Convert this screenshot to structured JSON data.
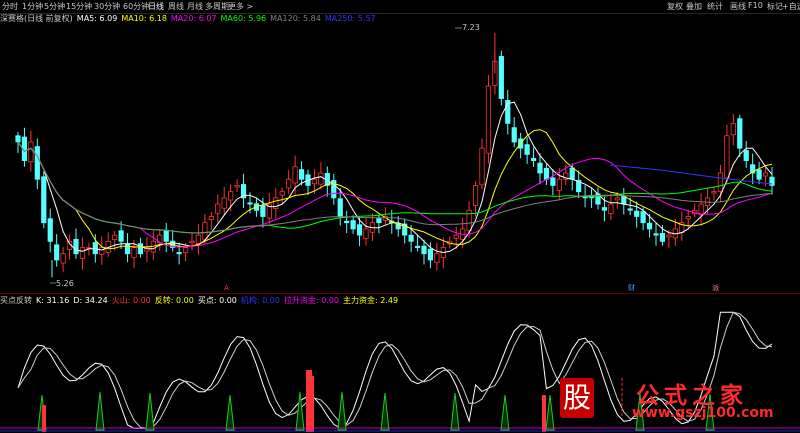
{
  "periods": [
    "分时",
    "1分钟",
    "5分钟",
    "15分钟",
    "30分钟",
    "60分钟",
    "日线",
    "周线",
    "月线",
    "多周期",
    "更多 >"
  ],
  "active_period": "日线",
  "toolbar": [
    "复权",
    "叠加",
    "统计",
    "画线",
    "F10",
    "标记",
    "+自选"
  ],
  "main_info": {
    "stock": "深赛格(日线 前复权)",
    "ma5": "MA5: 6.09",
    "ma10": "MA10: 6.18",
    "ma20": "MA20: 6.07",
    "ma60": "MA60: 5.96",
    "ma120": "MA120: 5.84",
    "ma250": "MA250: 5.57"
  },
  "price_labels": {
    "high": "7.23",
    "low": "5.26"
  },
  "event_markers": [
    "A",
    "财",
    "派"
  ],
  "indicator_info": {
    "name": "买点反转",
    "k": "K: 31.16",
    "d": "D: 34.24",
    "huoshan": "火山: 0.00",
    "fanzhuan": "反转: 0.00",
    "maidian": "买点: 0.00",
    "jigou": "机构: 0.00",
    "zhuli_lagao": "拉升资金: 0.00",
    "zhuli_zijin": "主力资金: 2.49"
  },
  "watermark": {
    "logo_char": "股",
    "title": "公式之家",
    "url": "www.gszj100.com"
  },
  "colors": {
    "up": "#ff3333",
    "down": "#54ffff",
    "ma5": "#ffffff",
    "ma10": "#ffff00",
    "ma20": "#ff00ff",
    "ma60": "#00ff00",
    "ma120": "#808080",
    "ma250": "#3333ff",
    "accent_red": "#c40000"
  }
}
